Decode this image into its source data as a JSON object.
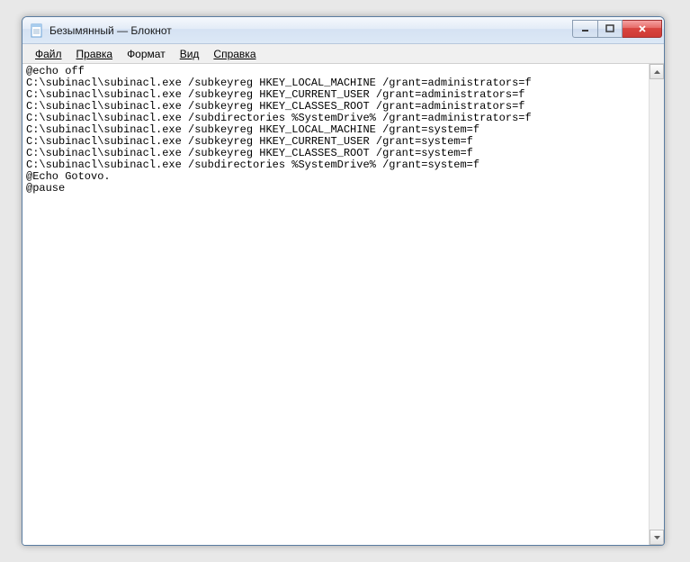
{
  "window": {
    "title": "Безымянный — Блокнот"
  },
  "menu": {
    "file": "Файл",
    "edit": "Правка",
    "format": "Формат",
    "view": "Вид",
    "help": "Справка"
  },
  "editor": {
    "content": "@echo off\nC:\\subinacl\\subinacl.exe /subkeyreg HKEY_LOCAL_MACHINE /grant=administrators=f\nC:\\subinacl\\subinacl.exe /subkeyreg HKEY_CURRENT_USER /grant=administrators=f\nC:\\subinacl\\subinacl.exe /subkeyreg HKEY_CLASSES_ROOT /grant=administrators=f\nC:\\subinacl\\subinacl.exe /subdirectories %SystemDrive% /grant=administrators=f\nC:\\subinacl\\subinacl.exe /subkeyreg HKEY_LOCAL_MACHINE /grant=system=f\nC:\\subinacl\\subinacl.exe /subkeyreg HKEY_CURRENT_USER /grant=system=f\nC:\\subinacl\\subinacl.exe /subkeyreg HKEY_CLASSES_ROOT /grant=system=f\nC:\\subinacl\\subinacl.exe /subdirectories %SystemDrive% /grant=system=f\n@Echo Gotovo.\n@pause\n"
  },
  "controls": {
    "minimize": "minimize",
    "maximize": "maximize",
    "close": "close"
  }
}
